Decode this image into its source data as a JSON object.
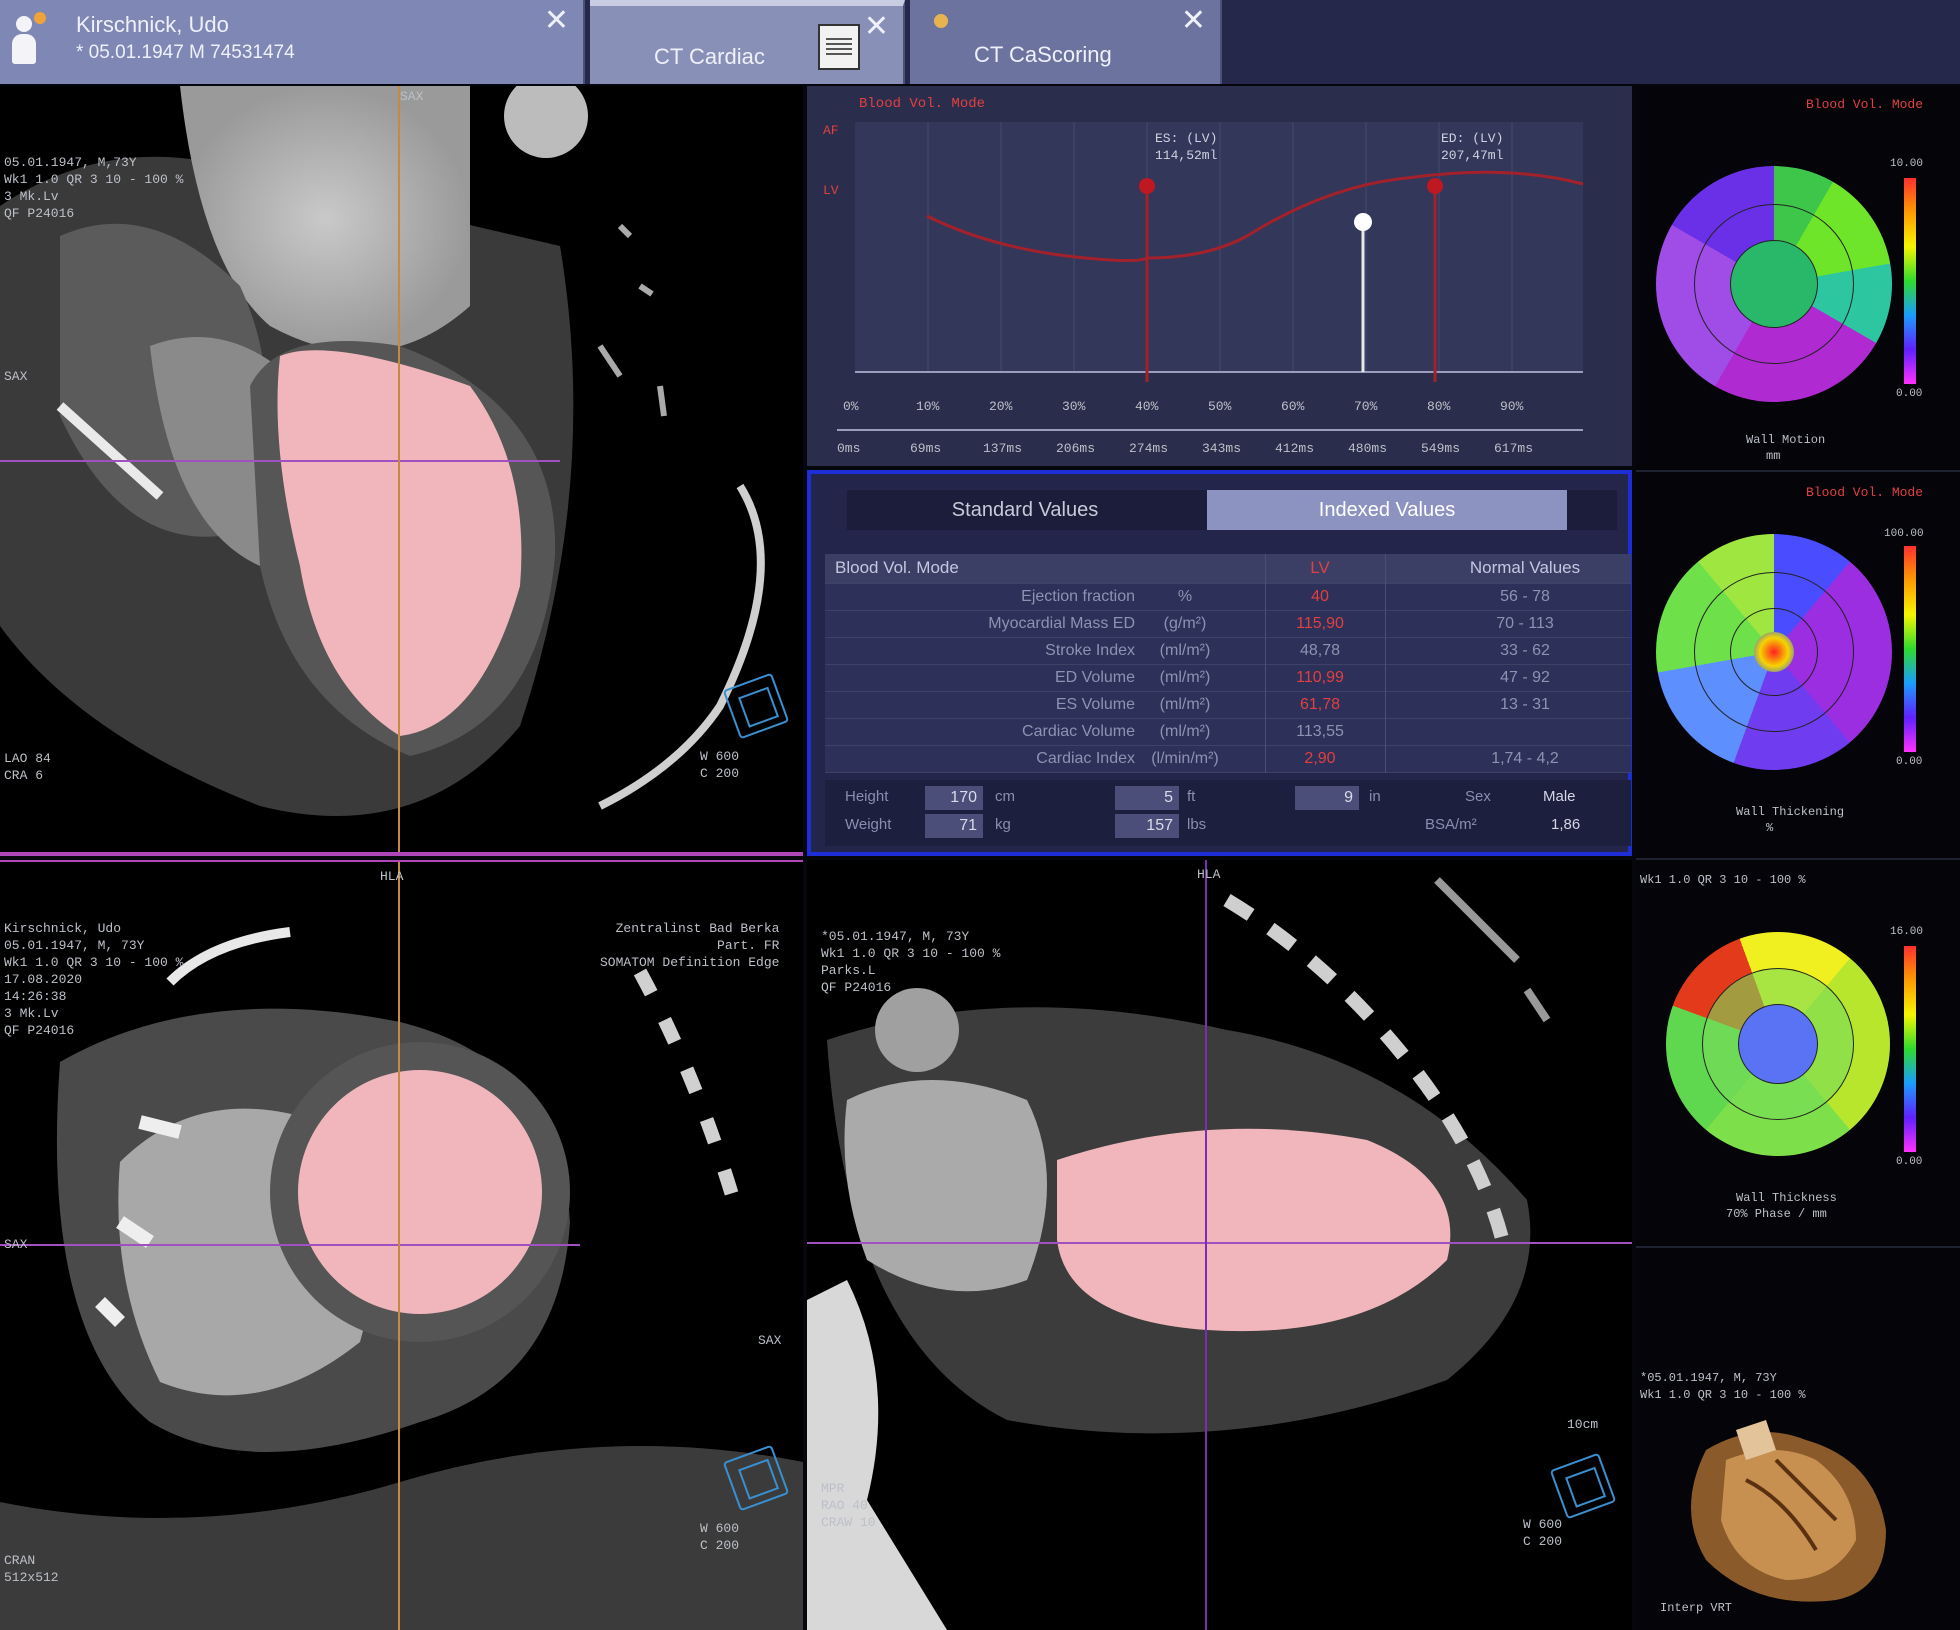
{
  "tabs": [
    {
      "label": "Kirschnick, Udo",
      "sub": "* 05.01.1947 M 74531474"
    },
    {
      "label": "CT Cardiac"
    },
    {
      "label": "CT CaScoring"
    }
  ],
  "views": {
    "tl": {
      "lines": [
        "05.01.1947, M,73Y",
        "Wk1 1.0 QR 3 10 - 100 %",
        "",
        "3 Mk.Lv",
        "QF P24016"
      ],
      "br": [
        "W   600",
        "C   200"
      ],
      "bl": [
        "LAO 84",
        "CRA 6"
      ],
      "left_mid": "SAX",
      "label_top": "SAX"
    },
    "bl": {
      "top": "HLA",
      "lines": [
        "Kirschnick, Udo",
        "05.01.1947, M, 73Y",
        "Wk1 1.0 QR 3 10 - 100 %",
        "",
        "17.08.2020",
        "14:26:38",
        "3 Mk.Lv",
        "QF P24016"
      ],
      "tr": [
        "Zentralinst Bad Berka",
        "Part. FR",
        "SOMATOM Definition Edge"
      ],
      "br": [
        "W   600",
        "C   200"
      ],
      "bl": [
        "CRAN",
        "512x512"
      ],
      "left_mid": "SAX",
      "right": "SAX"
    },
    "br": {
      "top": "HLA",
      "lines": [
        "*05.01.1947, M, 73Y",
        "Wk1 1.0 QR 3 10 - 100 %",
        "Parks.L",
        "QF P24016"
      ],
      "br": [
        "W   600",
        "C   200"
      ],
      "bl": [
        "MPR",
        "RAO 40",
        "CRAW 10"
      ],
      "scale": "10cm"
    }
  },
  "graph": {
    "title": "Blood Vol. Mode",
    "y_labels": [
      "AF",
      "LV"
    ],
    "markers": [
      {
        "label": "ES: (LV)",
        "value": "114,52ml"
      },
      {
        "label": "ED: (LV)",
        "value": "207,47ml"
      }
    ],
    "x_pct": [
      "0%",
      "10%",
      "20%",
      "30%",
      "40%",
      "50%",
      "60%",
      "70%",
      "80%",
      "90%"
    ],
    "x_ms": [
      "0ms",
      "69ms",
      "137ms",
      "206ms",
      "274ms",
      "343ms",
      "412ms",
      "480ms",
      "549ms",
      "617ms"
    ]
  },
  "table": {
    "tab_standard": "Standard Values",
    "tab_indexed": "Indexed Values",
    "headers": [
      "Blood Vol. Mode",
      "",
      "LV",
      "Normal Values"
    ],
    "rows": [
      {
        "label": "Ejection fraction",
        "unit": "%",
        "value": "40",
        "normal": "56 - 78"
      },
      {
        "label": "Myocardial Mass ED",
        "unit": "(g/m²)",
        "value": "115,90",
        "normal": "70 - 113"
      },
      {
        "label": "Stroke Index",
        "unit": "(ml/m²)",
        "value": "48,78",
        "normal": "33 - 62"
      },
      {
        "label": "ED Volume",
        "unit": "(ml/m²)",
        "value": "110,99",
        "normal": "47 - 92"
      },
      {
        "label": "ES Volume",
        "unit": "(ml/m²)",
        "value": "61,78",
        "normal": "13 - 31"
      },
      {
        "label": "Cardiac Volume",
        "unit": "(ml/m²)",
        "value": "113,55",
        "normal": ""
      },
      {
        "label": "Cardiac Index",
        "unit": "(l/min/m²)",
        "value": "2,90",
        "normal": "1,74 - 4,2"
      }
    ],
    "footer": {
      "height_label": "Height",
      "height_val": "170",
      "height_unit": "cm",
      "weight_label": "Weight",
      "weight_val": "71",
      "weight_unit": "kg",
      "ft_val": "5",
      "ft_unit": "ft",
      "lbs_val": "157",
      "lbs_unit": "lbs",
      "in_val": "9",
      "in_unit": "in",
      "sex_label": "Sex",
      "sex_val": "Male",
      "bsa_label": "BSA/m²",
      "bsa_val": "1,86"
    }
  },
  "bullseyes": [
    {
      "title": "Blood Vol. Mode",
      "caption": "Wall Motion",
      "sub": "mm",
      "scale_top": "10.00",
      "scale_bot": "0.00"
    },
    {
      "title": "Blood Vol. Mode",
      "caption": "Wall Thickening",
      "sub": "%",
      "scale_top": "100.00",
      "scale_bot": "0.00"
    },
    {
      "title": "Wk1 1.0 QR 3 10 - 100 %",
      "caption": "Wall Thickness",
      "sub": "70% Phase / mm",
      "scale_top": "16.00",
      "scale_bot": "0.00"
    }
  ],
  "vr": {
    "lines": [
      "*05.01.1947, M, 73Y",
      "Wk1 1.0 QR 3 10 - 100 %"
    ],
    "bottom": "Interp VRT"
  },
  "colors": {
    "accent_purple": "#b047b8",
    "table_border": "#1e2ed6",
    "curve": "#a3212b",
    "lv_overlay": "#f0b6bb"
  }
}
